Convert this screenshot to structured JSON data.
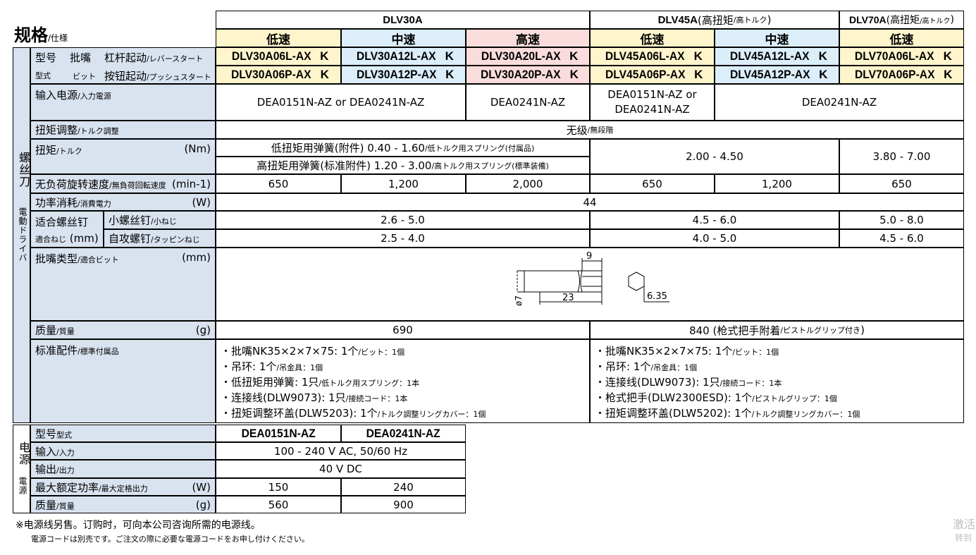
{
  "spec": {
    "title_main": "规格",
    "title_sub": "/仕様"
  },
  "series": [
    {
      "name": "DLV30A",
      "note_main": "",
      "note_sub": ""
    },
    {
      "name": "DLV45A",
      "note_main": " (高扭矩",
      "note_sub": "/高トルク",
      "note_end": ")"
    },
    {
      "name": "DLV70A",
      "note_main": " (高扭矩",
      "note_sub": "/高トルク",
      "note_end": ")"
    }
  ],
  "speeds": [
    "低速",
    "中速",
    "高速",
    "低速",
    "中速",
    "低速"
  ],
  "models_lever": [
    "DLV30A06L-AX",
    "DLV30A12L-AX",
    "DLV30A20L-AX",
    "DLV45A06L-AX",
    "DLV45A12L-AX",
    "DLV70A06L-AX"
  ],
  "models_push": [
    "DLV30A06P-AX",
    "DLV30A12P-AX",
    "DLV30A20P-AX",
    "DLV45A06P-AX",
    "DLV45A12P-AX",
    "DLV70A06P-AX"
  ],
  "k_suffix": "K",
  "labels": {
    "model_main": "型号",
    "model_sub": "型式",
    "bit_main": "批嘴",
    "bit_sub": "ビット",
    "lever_main": "杠杆起动",
    "lever_sub": "/レバースタート",
    "push_main": "按钮起动",
    "push_sub": "/プッシュスタート",
    "input_power_main": "输入电源",
    "input_power_sub": "/入力電源",
    "torque_adj_main": "扭矩调整",
    "torque_adj_sub": "/トルク調整",
    "torque_main": "扭矩",
    "torque_sub": "/トルク",
    "torque_unit": "(Nm)",
    "speed_main": "无负荷旋转速度",
    "speed_sub": "/無負荷回転速度",
    "speed_unit": "(min-1)",
    "power_main": "功率消耗",
    "power_sub": "/消費電力",
    "power_unit": "(W)",
    "screw_main": "适合螺丝钉",
    "screw_sub": "適合ねじ",
    "screw_unit": "(mm)",
    "small_screw_main": "小螺丝钉",
    "small_screw_sub": "/小ねじ",
    "tapping_main": "自攻螺钉",
    "tapping_sub": "/タッピンねじ",
    "bit_type_main": "批嘴类型",
    "bit_type_sub": "/適合ビット",
    "bit_type_unit": "(mm)",
    "mass_main": "质量",
    "mass_sub": "/質量",
    "mass_unit": "(g)",
    "accessory_main": "标准配件",
    "accessory_sub": "/標準付属品"
  },
  "side_driver_main": "螺丝刀",
  "side_driver_sub": "電動ドライバ",
  "side_power_main": "电源",
  "side_power_sub": "電源",
  "values": {
    "input_power_a": "DEA0151N-AZ or DEA0241N-AZ",
    "input_power_b": "DEA0241N-AZ",
    "input_power_c1": "DEA0151N-AZ or",
    "input_power_c2": "DEA0241N-AZ",
    "input_power_d": "DEA0241N-AZ",
    "torque_adj_main": "无级",
    "torque_adj_sub": "/無段階",
    "torque_low_main": "低扭矩用弹簧(附件) 0.40 - 1.60",
    "torque_low_sub": "/低トルク用スプリング(付属品)",
    "torque_high_main": "高扭矩用弹簧(标准附件) 1.20 - 3.00",
    "torque_high_sub": "/高トルク用スプリング(標準装備)",
    "torque_45": "2.00 - 4.50",
    "torque_70": "3.80 - 7.00",
    "speeds": [
      "650",
      "1,200",
      "2,000",
      "650",
      "1,200",
      "650"
    ],
    "power": "44",
    "small_screw": [
      "2.6 - 5.0",
      "4.5 - 6.0",
      "5.0 - 8.0"
    ],
    "tapping_screw": [
      "2.5 - 4.0",
      "4.0 - 5.0",
      "4.5 - 6.0"
    ],
    "bit_dims": {
      "d": "ø7",
      "len": "23",
      "tip": "9",
      "hex": "6.35"
    },
    "mass_30": "690",
    "mass_45_main": "840 (枪式把手附着",
    "mass_45_sub": "/ピストルグリップ付き",
    "mass_45_end": ")"
  },
  "accessories_left": [
    {
      "main": "・批嘴NK35×2×7×75: 1个",
      "sub": "/ビット：1個"
    },
    {
      "main": "・吊环: 1个",
      "sub": "/吊金具：1個"
    },
    {
      "main": "・低扭矩用弹簧: 1只",
      "sub": "/低トルク用スプリング：1本"
    },
    {
      "main": "・连接线(DLW9073): 1只",
      "sub": "/接続コード：1本"
    },
    {
      "main": "・扭矩调整环盖(DLW5203): 1个",
      "sub": "/トルク調整リングカバー：1個"
    }
  ],
  "accessories_right": [
    {
      "main": "・批嘴NK35×2×7×75: 1个",
      "sub": "/ビット：1個"
    },
    {
      "main": "・吊环: 1个",
      "sub": "/吊金具：1個"
    },
    {
      "main": "・连接线(DLW9073): 1只",
      "sub": "/接続コード：1本"
    },
    {
      "main": "・枪式把手(DLW2300ESD): 1个",
      "sub": "/ピストルグリップ：1個"
    },
    {
      "main": "・扭矩调整环盖(DLW5202): 1个",
      "sub": "/トルク調整リングカバー：1個"
    }
  ],
  "power_supply": {
    "models": [
      "DEA0151N-AZ",
      "DEA0241N-AZ"
    ],
    "input_main": "输入",
    "input_sub": "/入力",
    "input_value": "100 - 240 V AC, 50/60 Hz",
    "output_main": "输出",
    "output_sub": "/出力",
    "output_value": "40 V DC",
    "max_main": "最大额定功率",
    "max_sub": "/最大定格出力",
    "max_unit": "(W)",
    "max_values": [
      "150",
      "240"
    ],
    "mass_main": "质量",
    "mass_sub": "/質量",
    "mass_unit": "(g)",
    "mass_values": [
      "560",
      "900"
    ]
  },
  "footnote_main": "※电源线另售。订购时，可向本公司咨询所需的电源线。",
  "footnote_sub": "電源コードは別売です。ご注文の際に必要な電源コードをお申し付けください。",
  "watermark": [
    "激活",
    "转到"
  ]
}
